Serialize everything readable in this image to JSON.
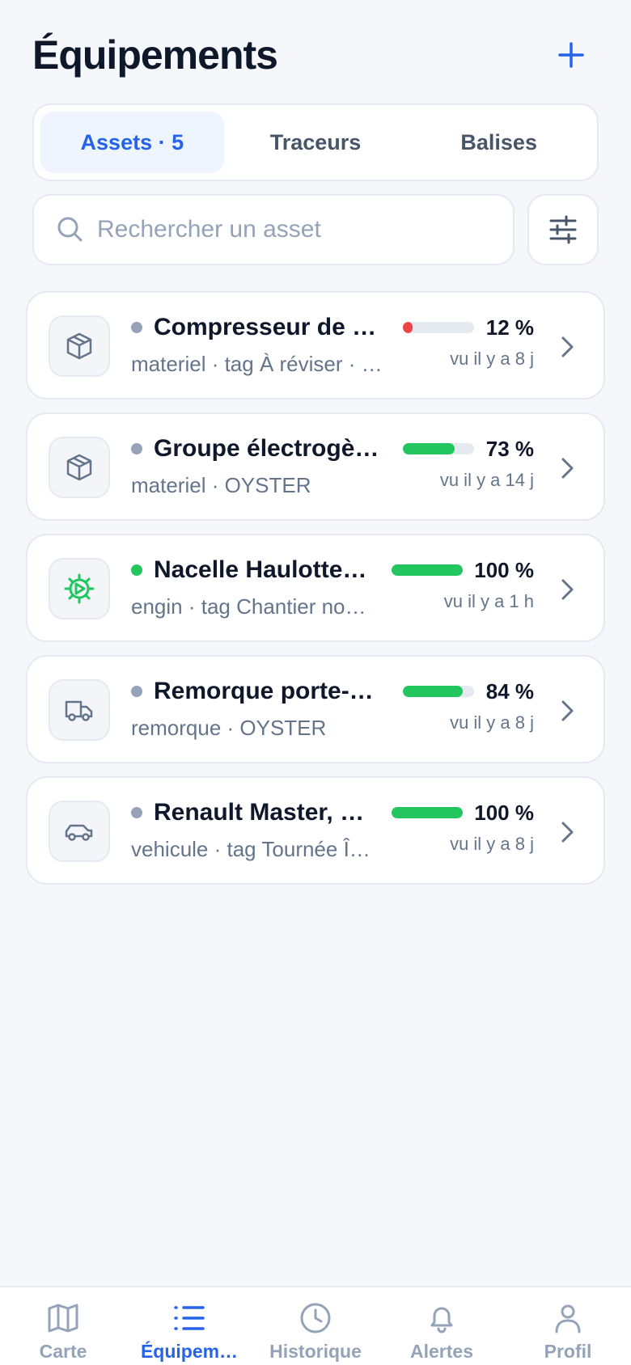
{
  "header": {
    "title": "Équipements",
    "add_icon": "plus-icon"
  },
  "tabs": [
    {
      "label": "Assets · 5",
      "active": true
    },
    {
      "label": "Traceurs",
      "active": false
    },
    {
      "label": "Balises",
      "active": false
    }
  ],
  "search": {
    "placeholder": "Rechercher un asset",
    "filter_icon": "sliders-icon"
  },
  "assets": [
    {
      "name": "Compresseur de …",
      "meta": "materiel · tag À réviser · …",
      "battery_percent": 12,
      "battery_label": "12 %",
      "last_seen": "vu il y a 8 j",
      "icon": "box-icon",
      "status_color": "#94a3b8",
      "bar_color": "#ef4444"
    },
    {
      "name": "Groupe électrogè…",
      "meta": "materiel · OYSTER",
      "battery_percent": 73,
      "battery_label": "73 %",
      "last_seen": "vu il y a 14 j",
      "icon": "box-icon",
      "status_color": "#94a3b8",
      "bar_color": "#22c55e"
    },
    {
      "name": "Nacelle Haulotte…",
      "meta": "engin · tag Chantier no…",
      "battery_percent": 100,
      "battery_label": "100 %",
      "last_seen": "vu il y a 1 h",
      "icon": "gear-icon",
      "status_color": "#22c55e",
      "bar_color": "#22c55e"
    },
    {
      "name": "Remorque porte-…",
      "meta": "remorque · OYSTER",
      "battery_percent": 84,
      "battery_label": "84 %",
      "last_seen": "vu il y a 8 j",
      "icon": "truck-icon",
      "status_color": "#94a3b8",
      "bar_color": "#22c55e"
    },
    {
      "name": "Renault Master, …",
      "meta": "vehicule · tag Tournée Î…",
      "battery_percent": 100,
      "battery_label": "100 %",
      "last_seen": "vu il y a 8 j",
      "icon": "car-icon",
      "status_color": "#94a3b8",
      "bar_color": "#22c55e"
    }
  ],
  "bottom_nav": [
    {
      "label": "Carte",
      "icon": "map-icon",
      "active": false
    },
    {
      "label": "Équipem…",
      "icon": "list-icon",
      "active": true
    },
    {
      "label": "Historique",
      "icon": "clock-icon",
      "active": false
    },
    {
      "label": "Alertes",
      "icon": "bell-icon",
      "active": false
    },
    {
      "label": "Profil",
      "icon": "user-icon",
      "active": false
    }
  ],
  "colors": {
    "accent": "#2563eb",
    "battery_low": "#ef4444",
    "battery_ok": "#22c55e",
    "muted": "#94a3b8"
  }
}
